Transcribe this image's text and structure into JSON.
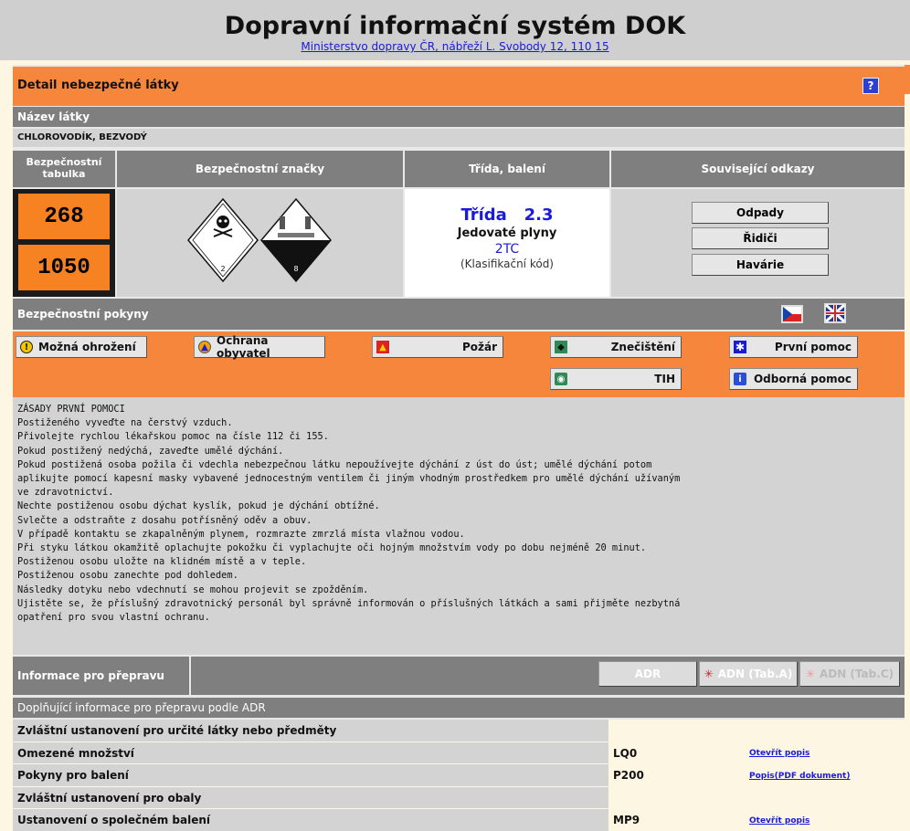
{
  "header": {
    "title": "Dopravní informační systém DOK",
    "subtitle": "Ministerstvo dopravy ČR, nábřeží L. Svobody 12, 110 15"
  },
  "detail": {
    "title": "Detail nebezpečné látky",
    "help_label": "?",
    "substance_label": "Název látky",
    "substance_name": "CHLOROVODÍK, BEZVODÝ"
  },
  "columns": {
    "safety_table": "Bezpečnostní tabulka",
    "safety_signs": "Bezpečnostní značky",
    "class_packing": "Třída, balení",
    "related_links": "Související odkazy"
  },
  "hazard_plate": {
    "top": "268",
    "bottom": "1050"
  },
  "labels": {
    "left_number": "2",
    "right_number": "8"
  },
  "classification": {
    "class_text": "Třída   2.3",
    "class_name": "Jedovaté plyny",
    "code": "2TC",
    "code_label": "(Klasifikační kód)"
  },
  "related": [
    "Odpady",
    "Řidiči",
    "Havárie"
  ],
  "safety": {
    "title": "Bezpečnostní pokyny",
    "buttons": [
      {
        "label": "Možná ohrožení",
        "icon": "warning-icon"
      },
      {
        "label": "Ochrana obyvatel",
        "icon": "civil-protection-icon"
      },
      {
        "label": "Požár",
        "icon": "fire-icon"
      },
      {
        "label": "Znečištění",
        "icon": "pollution-icon"
      },
      {
        "label": "První pomoc",
        "icon": "first-aid-icon"
      },
      {
        "label": "TIH",
        "icon": "tih-icon"
      },
      {
        "label": "Odborná pomoc",
        "icon": "info-icon"
      }
    ],
    "instructions": "ZÁSADY PRVNÍ POMOCI\nPostiženého vyveďte na čerstvý vzduch.\nPřivolejte rychlou lékařskou pomoc na čísle 112 či 155.\nPokud postižený nedýchá, zaveďte umělé dýchání.\nPokud postižená osoba požila či vdechla nebezpečnou látku nepoužívejte dýchání z úst do úst; umělé dýchání potom\naplikujte pomocí kapesní masky vybavené jednocestným ventilem či jiným vhodným prostředkem pro umělé dýchání užívaným\nve zdravotnictví.\nNechte postiženou osobu dýchat kyslík, pokud je dýchání obtížné.\nSvlečte a odstraňte z dosahu potřísněný oděv a obuv.\nV případě kontaktu se zkapalněným plynem, rozmrazte zmrzlá místa vlažnou vodou.\nPři styku látkou okamžitě oplachujte pokožku či vyplachujte oči hojným množstvím vody po dobu nejméně 20 minut.\nPostiženou osobu uložte na klidném místě a v teple.\nPostiženou osobu zanechte pod dohledem.\nNásledky dotyku nebo vdechnutí se mohou projevit se zpožděním.\nUjistěte se, že příslušný zdravotnický personál byl správně informován o příslušných látkách a sami přijměte nezbytná\nopatření pro svou vlastní ochranu."
  },
  "transport": {
    "title": "Informace pro přepravu",
    "tabs": [
      "ADR",
      "ADN (Tab.A)",
      "ADN (Tab.C)"
    ],
    "subheader": "Doplňující informace pro přepravu podle ADR",
    "rows": [
      {
        "label": "Zvláštní ustanovení pro určité látky nebo předměty",
        "value": "",
        "link": ""
      },
      {
        "label": "Omezené množství",
        "value": "LQ0",
        "link": "Otevřít popis"
      },
      {
        "label": "Pokyny pro balení",
        "value": "P200",
        "link": "Popis(PDF dokument)"
      },
      {
        "label": "Zvláštní ustanovení pro obaly",
        "value": "",
        "link": ""
      },
      {
        "label": "Ustanovení o společném balení",
        "value": "MP9",
        "link": "Otevřít popis"
      }
    ]
  },
  "colors": {
    "orange": "#f5863b",
    "header_gray": "#7f7f7f",
    "link_blue": "#1a1adb"
  }
}
